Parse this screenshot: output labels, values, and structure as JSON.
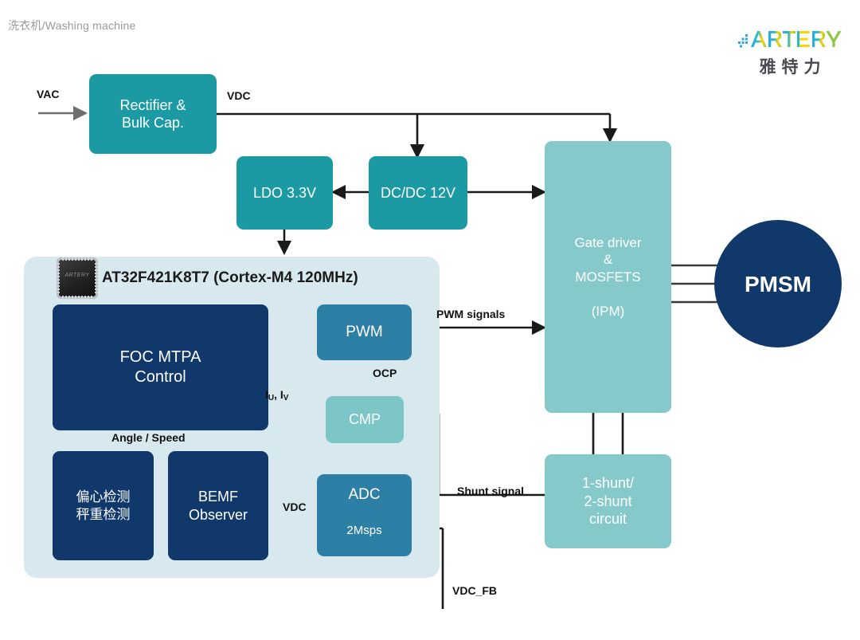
{
  "caption": "洗衣机/Washing machine",
  "logo": {
    "wordmark": "ARTERY",
    "chinese": "雅特力",
    "colors": {
      "blue": "#29abe2",
      "yellow": "#ffd400",
      "green": "#8dc63f",
      "cyan": "#2eb8c8"
    }
  },
  "colors": {
    "teal": "#1b9aa4",
    "aqua": "#7cc6c8",
    "mint": "#86c9cb",
    "steel": "#2d7fa6",
    "navy": "#10386b",
    "panel": "#d7e9ef",
    "wire_black": "#1a1a1a",
    "wire_blue": "#4e93cf",
    "wire_gray": "#6e6e6e"
  },
  "mcu": {
    "title": "AT32F421K8T7 (Cortex-M4 120MHz)",
    "chip_mark": "ARTERY"
  },
  "blocks": {
    "rectifier": {
      "lines": [
        "Rectifier &",
        "Bulk Cap."
      ]
    },
    "ldo": {
      "lines": [
        "LDO 3.3V"
      ]
    },
    "dcdc": {
      "lines": [
        "DC/DC 12V"
      ]
    },
    "gate_driver": {
      "lines": [
        "Gate driver",
        "&",
        "MOSFETS",
        "",
        "(IPM)"
      ]
    },
    "pmsm": {
      "lines": [
        "PMSM"
      ]
    },
    "shunt": {
      "lines": [
        "1-shunt/",
        "2-shunt",
        "circuit"
      ]
    },
    "foc": {
      "lines": [
        "FOC MTPA",
        "Control"
      ]
    },
    "pwm": {
      "lines": [
        "PWM"
      ]
    },
    "cmp": {
      "lines": [
        "CMP"
      ]
    },
    "adc": {
      "lines": [
        "ADC",
        "2Msps"
      ]
    },
    "eccentric": {
      "lines": [
        "偏心检测",
        "秤重检测"
      ]
    },
    "bemf": {
      "lines": [
        "BEMF",
        "Observer"
      ]
    }
  },
  "signals": {
    "vac": "VAC",
    "vdc_top": "VDC",
    "pwm_signals": "PWM signals",
    "ocp": "OCP",
    "iuiv_main": "I",
    "iuiv_sub1": "U",
    "iuiv_mid": ", I",
    "iuiv_sub2": "V",
    "angle_speed": "Angle / Speed",
    "vdc_inner": "VDC",
    "shunt_signal": "Shunt signal",
    "vdc_fb": "VDC_FB"
  }
}
